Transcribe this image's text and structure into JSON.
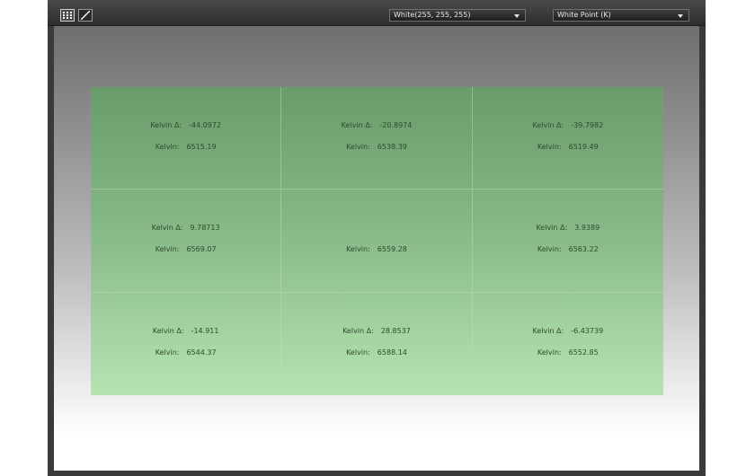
{
  "toolbar": {
    "color_select": "White(255, 255, 255)",
    "metric_select": "White Point (K)"
  },
  "labels": {
    "delta": "Kelvin Δ:",
    "kelvin": "Kelvin:"
  },
  "cells": [
    {
      "delta": "-44.0972",
      "kelvin": "6515.19"
    },
    {
      "delta": "-20.8974",
      "kelvin": "6538.39"
    },
    {
      "delta": "-39.7982",
      "kelvin": "6519.49"
    },
    {
      "delta": "9.78713",
      "kelvin": "6569.07"
    },
    {
      "delta": null,
      "kelvin": "6559.28"
    },
    {
      "delta": "3.9389",
      "kelvin": "6563.22"
    },
    {
      "delta": "-14.911",
      "kelvin": "6544.37"
    },
    {
      "delta": "28.8537",
      "kelvin": "6588.14"
    },
    {
      "delta": "-6.43739",
      "kelvin": "6552.85"
    }
  ]
}
